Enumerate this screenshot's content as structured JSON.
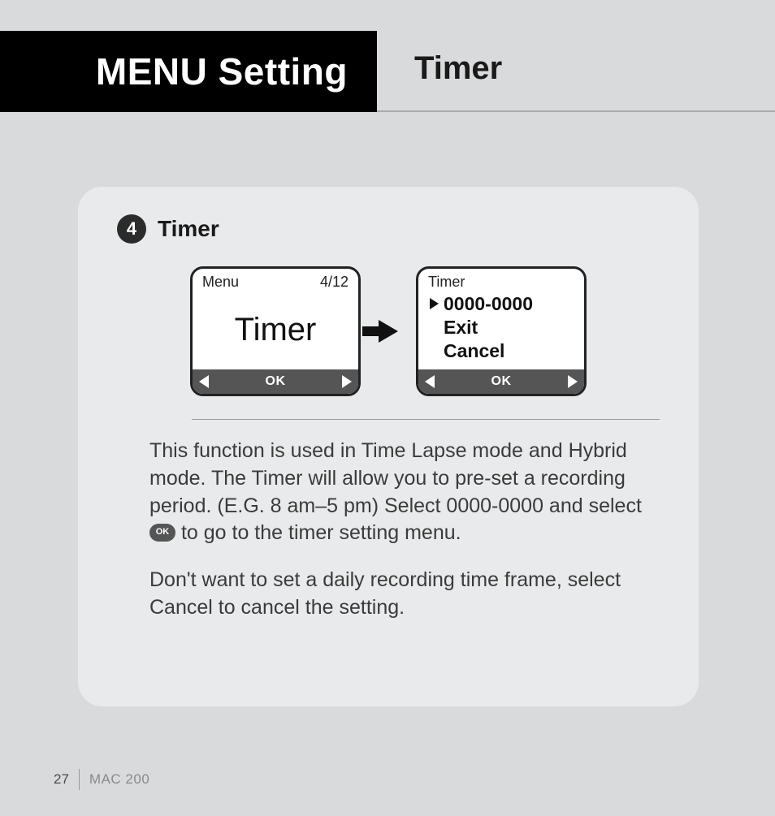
{
  "header": {
    "section": "MENU Setting",
    "subtitle": "Timer"
  },
  "card": {
    "step_number": "4",
    "title": "Timer",
    "screen1": {
      "top_left": "Menu",
      "top_right": "4/12",
      "center": "Timer",
      "ok": "OK"
    },
    "screen2": {
      "top_left": "Timer",
      "items": {
        "selected": "0000-0000",
        "exit": "Exit",
        "cancel": "Cancel"
      },
      "ok": "OK"
    },
    "description": {
      "p1_a": "This function is used in Time Lapse mode and Hybrid mode. The Timer will allow you to pre-set a recording period. (E.G. 8 am–5 pm)  Select 0000-0000 and select ",
      "p1_ok": "OK",
      "p1_b": " to go to the timer setting menu.",
      "p2": "Don't want to set a daily recording time frame, select Cancel to cancel the setting."
    }
  },
  "footer": {
    "page": "27",
    "model": "MAC 200"
  }
}
